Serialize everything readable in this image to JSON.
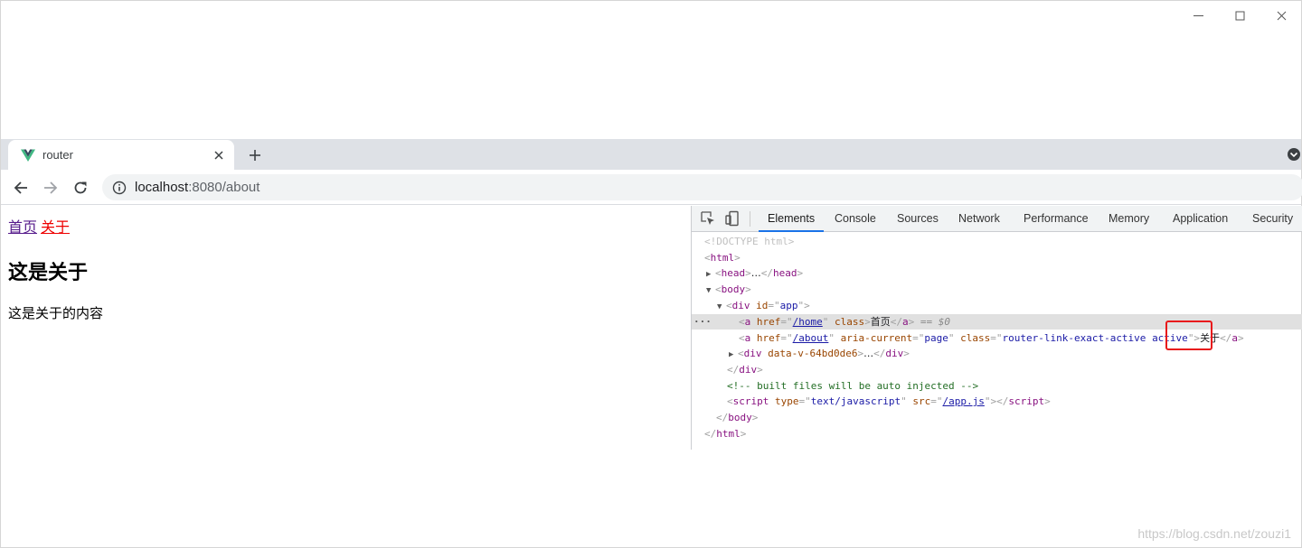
{
  "window": {
    "minimize_icon": "minimize-icon",
    "maximize_icon": "maximize-icon",
    "close_icon": "close-icon"
  },
  "tab": {
    "title": "router",
    "favicon": "vue-logo-icon",
    "accent": "#41b883"
  },
  "toolbar": {
    "url_host": "localhost",
    "url_path": ":8080/about"
  },
  "page": {
    "link_home": "首页",
    "link_about": "关于",
    "heading": "这是关于",
    "paragraph": "这是关于的内容",
    "colors": {
      "visited": "#551a8b",
      "active": "#ee0000"
    }
  },
  "devtools": {
    "tabs": [
      "Elements",
      "Console",
      "Sources",
      "Network",
      "Performance",
      "Memory",
      "Application",
      "Security"
    ],
    "active_tab": "Elements",
    "dom": {
      "doctype": "<!DOCTYPE html>",
      "html_open": "html",
      "head": "head",
      "head_ellipsis": "…",
      "body": "body",
      "div": "div",
      "div_id_attr": "id",
      "div_id_val": "app",
      "a": "a",
      "href_attr": "href",
      "home_href": "/home",
      "class_attr": "class",
      "home_text": "首页",
      "eq_ref": "== $0",
      "about_href": "/about",
      "aria_attr": "aria-current",
      "aria_val": "page",
      "about_class_a": "router-link-exact-active ",
      "about_class_b": "active",
      "about_text": "关于",
      "div2_attr": "data-v-64bd0de6",
      "comment": "<!-- built files will be auto injected -->",
      "script": "script",
      "type_attr": "type",
      "type_val": "text/javascript",
      "src_attr": "src",
      "src_val": "/app.js"
    }
  },
  "watermark": "https://blog.csdn.net/zouzi1"
}
